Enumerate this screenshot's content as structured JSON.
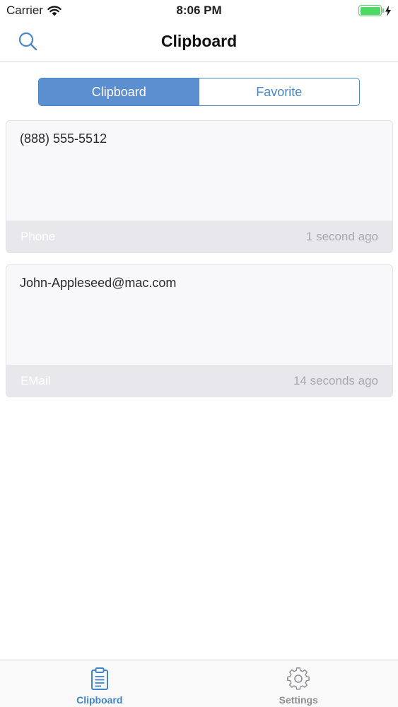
{
  "status_bar": {
    "carrier": "Carrier",
    "time": "8:06 PM",
    "battery_color": "#4cd964"
  },
  "nav": {
    "title": "Clipboard",
    "search_icon": "search-icon"
  },
  "segments": [
    {
      "label": "Clipboard",
      "active": true
    },
    {
      "label": "Favorite",
      "active": false
    }
  ],
  "clips": [
    {
      "content": "(888) 555-5512",
      "type": "Phone",
      "time": "1 second ago"
    },
    {
      "content": "John-Appleseed@mac.com",
      "type": "EMail",
      "time": "14 seconds ago"
    }
  ],
  "tabs": [
    {
      "label": "Clipboard",
      "icon": "clipboard-icon",
      "active": true
    },
    {
      "label": "Settings",
      "icon": "gear-icon",
      "active": false
    }
  ],
  "colors": {
    "accent": "#4a86c8",
    "segment_active_bg": "#5b8fcf",
    "tab_active": "#3f85c8",
    "tab_inactive": "#8e8e93"
  }
}
